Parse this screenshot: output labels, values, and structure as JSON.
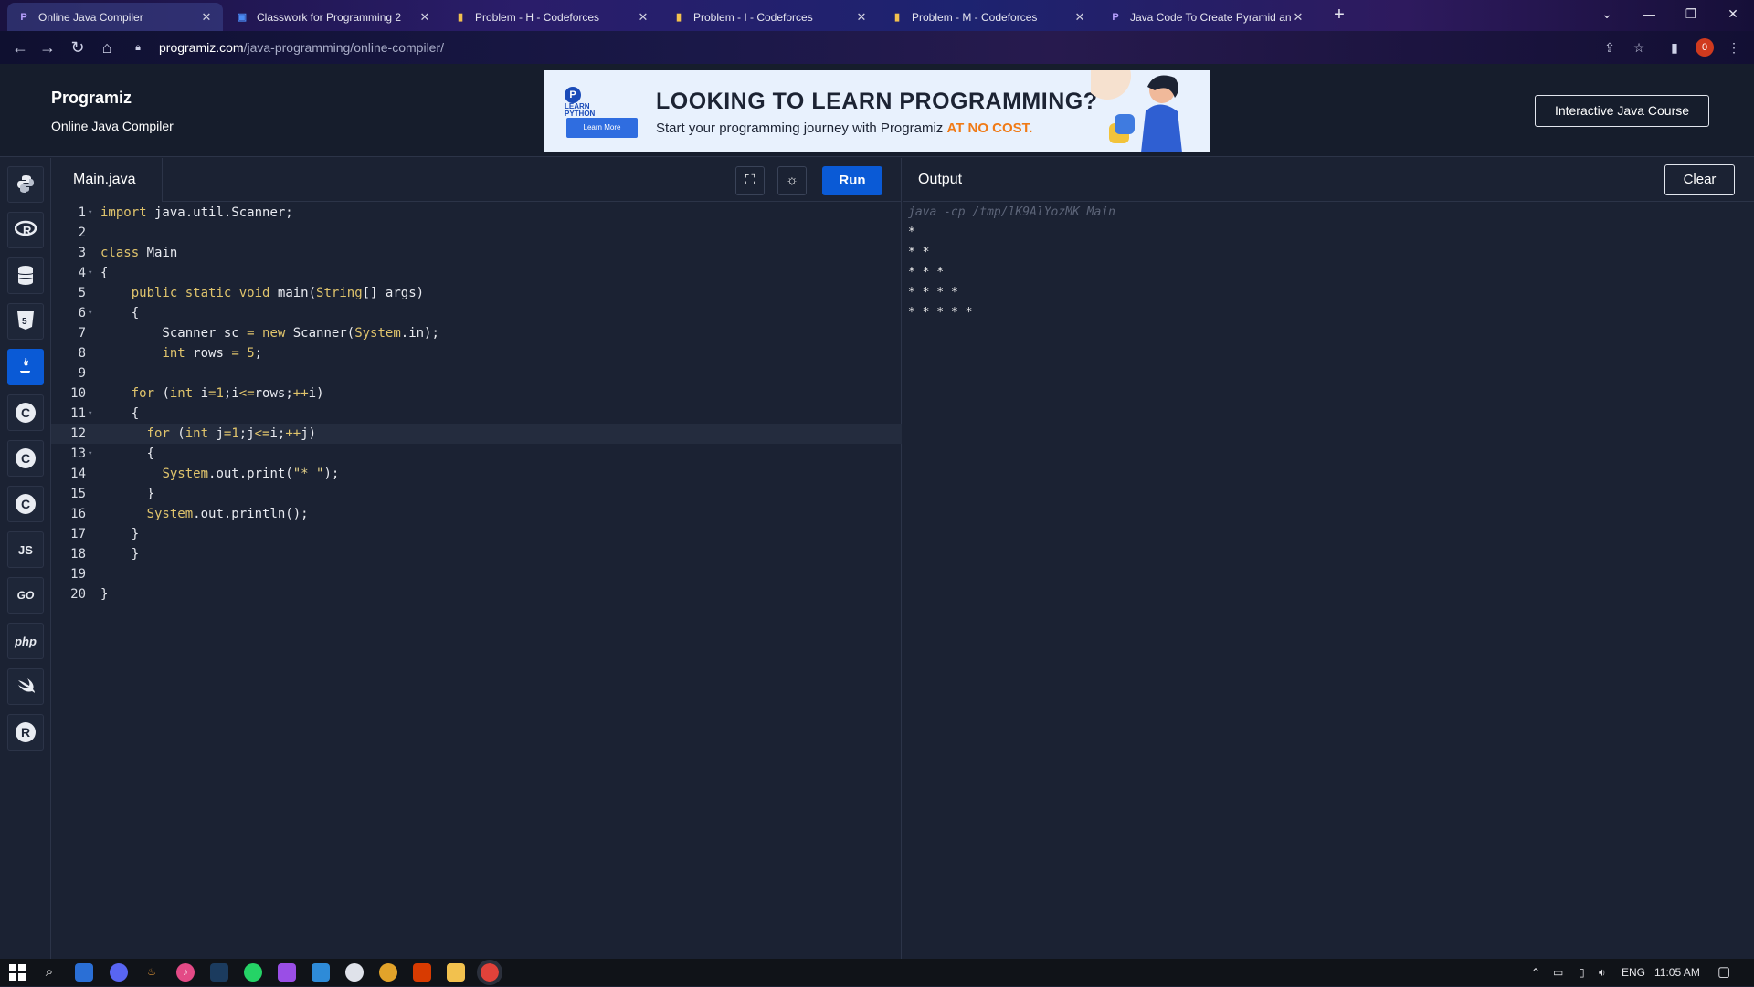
{
  "browser": {
    "tabs": [
      {
        "title": "Online Java Compiler",
        "favicon": "programiz-icon",
        "active": true
      },
      {
        "title": "Classwork for Programming 2",
        "favicon": "classroom-icon",
        "active": false
      },
      {
        "title": "Problem - H - Codeforces",
        "favicon": "codeforces-icon",
        "active": false
      },
      {
        "title": "Problem - I - Codeforces",
        "favicon": "codeforces-icon",
        "active": false
      },
      {
        "title": "Problem - M - Codeforces",
        "favicon": "codeforces-icon",
        "active": false
      },
      {
        "title": "Java Code To Create Pyramid and",
        "favicon": "programiz-icon",
        "active": false
      }
    ],
    "url_host": "programiz.com",
    "url_path": "/java-programming/online-compiler/",
    "profile_initial": "0"
  },
  "header": {
    "logo": "Programiz",
    "subtitle": "Online Java Compiler",
    "banner": {
      "badge_line1": "LEARN",
      "badge_line2": "PYTHON",
      "learn_more": "Learn More",
      "headline": "LOOKING TO LEARN PROGRAMMING?",
      "sub_prefix": "Start your programming journey with Programiz ",
      "sub_highlight": "AT NO COST."
    },
    "course_button": "Interactive Java Course"
  },
  "sidebar": {
    "languages": [
      {
        "name": "python",
        "glyph": "",
        "active": false
      },
      {
        "name": "r",
        "glyph": "",
        "active": false
      },
      {
        "name": "sql",
        "glyph": "",
        "active": false
      },
      {
        "name": "html",
        "glyph": "",
        "active": false
      },
      {
        "name": "java",
        "glyph": "",
        "active": true
      },
      {
        "name": "c",
        "glyph": "C",
        "active": false
      },
      {
        "name": "cpp",
        "glyph": "C",
        "active": false
      },
      {
        "name": "csharp",
        "glyph": "C",
        "active": false
      },
      {
        "name": "javascript",
        "glyph": "JS",
        "active": false
      },
      {
        "name": "go",
        "glyph": "GO",
        "active": false
      },
      {
        "name": "php",
        "glyph": "php",
        "active": false
      },
      {
        "name": "swift",
        "glyph": "",
        "active": false
      },
      {
        "name": "rust",
        "glyph": "R",
        "active": false
      }
    ]
  },
  "editor": {
    "filename": "Main.java",
    "run_label": "Run",
    "current_line": 12,
    "lines": [
      {
        "n": "1",
        "fold": true,
        "text": "import java.util.Scanner;"
      },
      {
        "n": "2",
        "fold": false,
        "text": ""
      },
      {
        "n": "3",
        "fold": false,
        "text": "class Main"
      },
      {
        "n": "4",
        "fold": true,
        "text": "{"
      },
      {
        "n": "5",
        "fold": false,
        "text": "    public static void main(String[] args)"
      },
      {
        "n": "6",
        "fold": true,
        "text": "    {"
      },
      {
        "n": "7",
        "fold": false,
        "text": "        Scanner sc = new Scanner(System.in);"
      },
      {
        "n": "8",
        "fold": false,
        "text": "        int rows = 5;"
      },
      {
        "n": "9",
        "fold": false,
        "text": ""
      },
      {
        "n": "10",
        "fold": false,
        "text": "    for (int i=1;i<=rows;++i)"
      },
      {
        "n": "11",
        "fold": true,
        "text": "    {"
      },
      {
        "n": "12",
        "fold": false,
        "text": "      for (int j=1;j<=i;++j)"
      },
      {
        "n": "13",
        "fold": true,
        "text": "      {"
      },
      {
        "n": "14",
        "fold": false,
        "text": "        System.out.print(\"* \");"
      },
      {
        "n": "15",
        "fold": false,
        "text": "      }"
      },
      {
        "n": "16",
        "fold": false,
        "text": "      System.out.println();"
      },
      {
        "n": "17",
        "fold": false,
        "text": "    }"
      },
      {
        "n": "18",
        "fold": false,
        "text": "    }"
      },
      {
        "n": "19",
        "fold": false,
        "text": ""
      },
      {
        "n": "20",
        "fold": false,
        "text": "}"
      }
    ]
  },
  "output": {
    "title": "Output",
    "clear_label": "Clear",
    "command": "java -cp /tmp/lK9AlYozMK Main",
    "lines": [
      "*",
      "* *",
      "* * *",
      "* * * *",
      "* * * * *"
    ]
  },
  "taskbar": {
    "language": "ENG",
    "time": "11:05 AM"
  },
  "colors": {
    "accent": "#0a5ad6",
    "background": "#1b2233",
    "keyword": "#e0c46c",
    "highlight": "#f07a16"
  }
}
